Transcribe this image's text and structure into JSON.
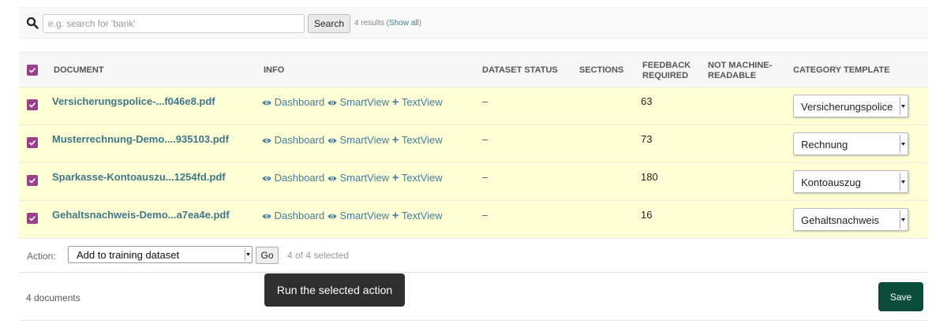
{
  "search": {
    "placeholder": "e.g. search for 'bank'",
    "button_label": "Search",
    "result_count": "4 results (",
    "show_all_label": "Show all",
    "result_count_end": ")"
  },
  "table": {
    "columns": [
      "Document",
      "Info",
      "Dataset status",
      "Sections",
      "Feedback required",
      "Not machine-readable",
      "Category template"
    ],
    "rows": [
      {
        "document": "Versicherungspolice-...f046e8.pdf",
        "status": "–",
        "sections": "",
        "feedback": "63",
        "not_machine_readable": "",
        "category": "Versicherungspolice"
      },
      {
        "document": "Musterrechnung-Demo....935103.pdf",
        "status": "–",
        "sections": "",
        "feedback": "73",
        "not_machine_readable": "",
        "category": "Rechnung"
      },
      {
        "document": "Sparkasse-Kontoauszu...1254fd.pdf",
        "status": "–",
        "sections": "",
        "feedback": "180",
        "not_machine_readable": "",
        "category": "Kontoauszug"
      },
      {
        "document": "Gehaltsnachweis-Demo...a7ea4e.pdf",
        "status": "–",
        "sections": "",
        "feedback": "16",
        "not_machine_readable": "",
        "category": "Gehaltsnachweis"
      }
    ],
    "info_links": {
      "dashboard": "Dashboard",
      "smartview": "SmartView",
      "textview": "TextView"
    }
  },
  "actions": {
    "label": "Action:",
    "selected": "Add to training dataset",
    "go_label": "Go",
    "selected_count": "4 of 4 selected"
  },
  "footer": {
    "count": "4 documents",
    "save_label": "Save"
  },
  "tooltip": {
    "text": "Run the selected action"
  },
  "icons": {
    "search": "search-icon",
    "checkbox": "checkbox-checked-icon",
    "eye": "eye-icon",
    "plus": "plus-icon",
    "dropdown": "dropdown-arrow-icon"
  },
  "colors": {
    "row_highlight": "#ffffd6",
    "checkbox": "#9b3f8b",
    "link": "#447e9b",
    "plus": "#4b9a2a",
    "save": "#0b4b3a",
    "tooltip": "#2f2f2f"
  }
}
